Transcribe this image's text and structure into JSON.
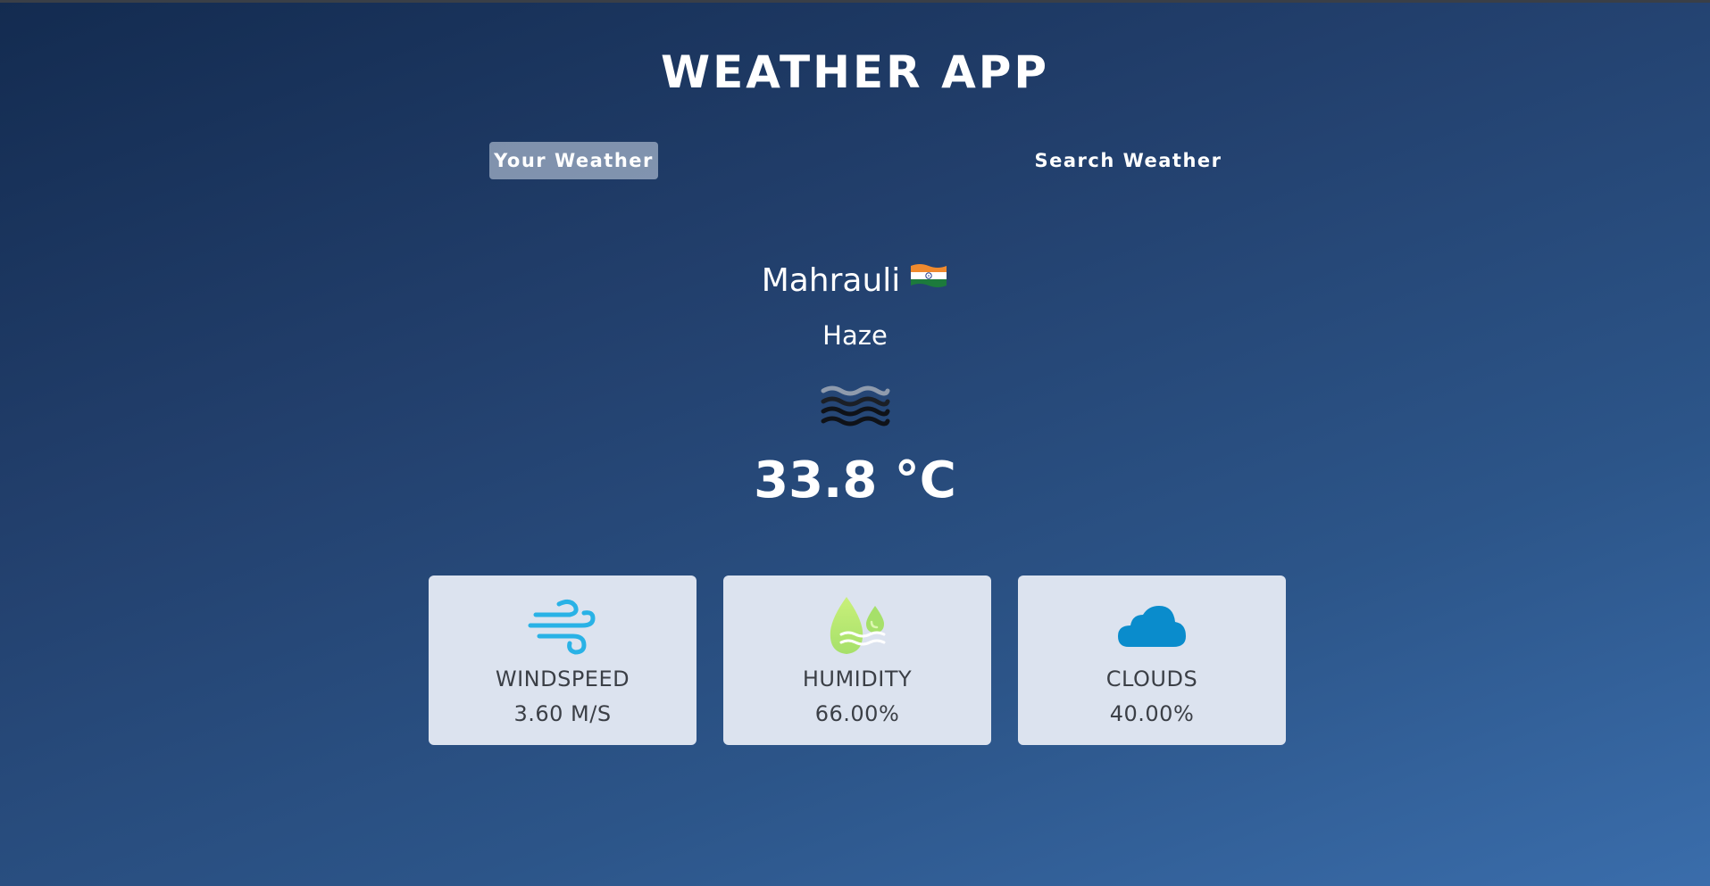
{
  "app": {
    "title": "WEATHER APP"
  },
  "tabs": [
    {
      "label": "Your Weather",
      "active": true
    },
    {
      "label": "Search Weather",
      "active": false
    }
  ],
  "weather": {
    "city": "Mahrauli",
    "country_flag": "india-flag-icon",
    "condition": "Haze",
    "condition_icon": "haze-icon",
    "temperature": "33.8 °C"
  },
  "stats": [
    {
      "label": "WINDSPEED",
      "value": "3.60 M/S",
      "icon": "wind-icon"
    },
    {
      "label": "HUMIDITY",
      "value": "66.00%",
      "icon": "humidity-icon"
    },
    {
      "label": "CLOUDS",
      "value": "40.00%",
      "icon": "cloud-icon"
    }
  ],
  "colors": {
    "background_start": "#132b50",
    "background_end": "#3a6dab",
    "card_background": "#dce3ef",
    "active_tab": "#9fb1ca",
    "wind_icon": "#29b2e6",
    "humidity_icon": "#b7e86a",
    "cloud_icon": "#0a8ccc"
  }
}
